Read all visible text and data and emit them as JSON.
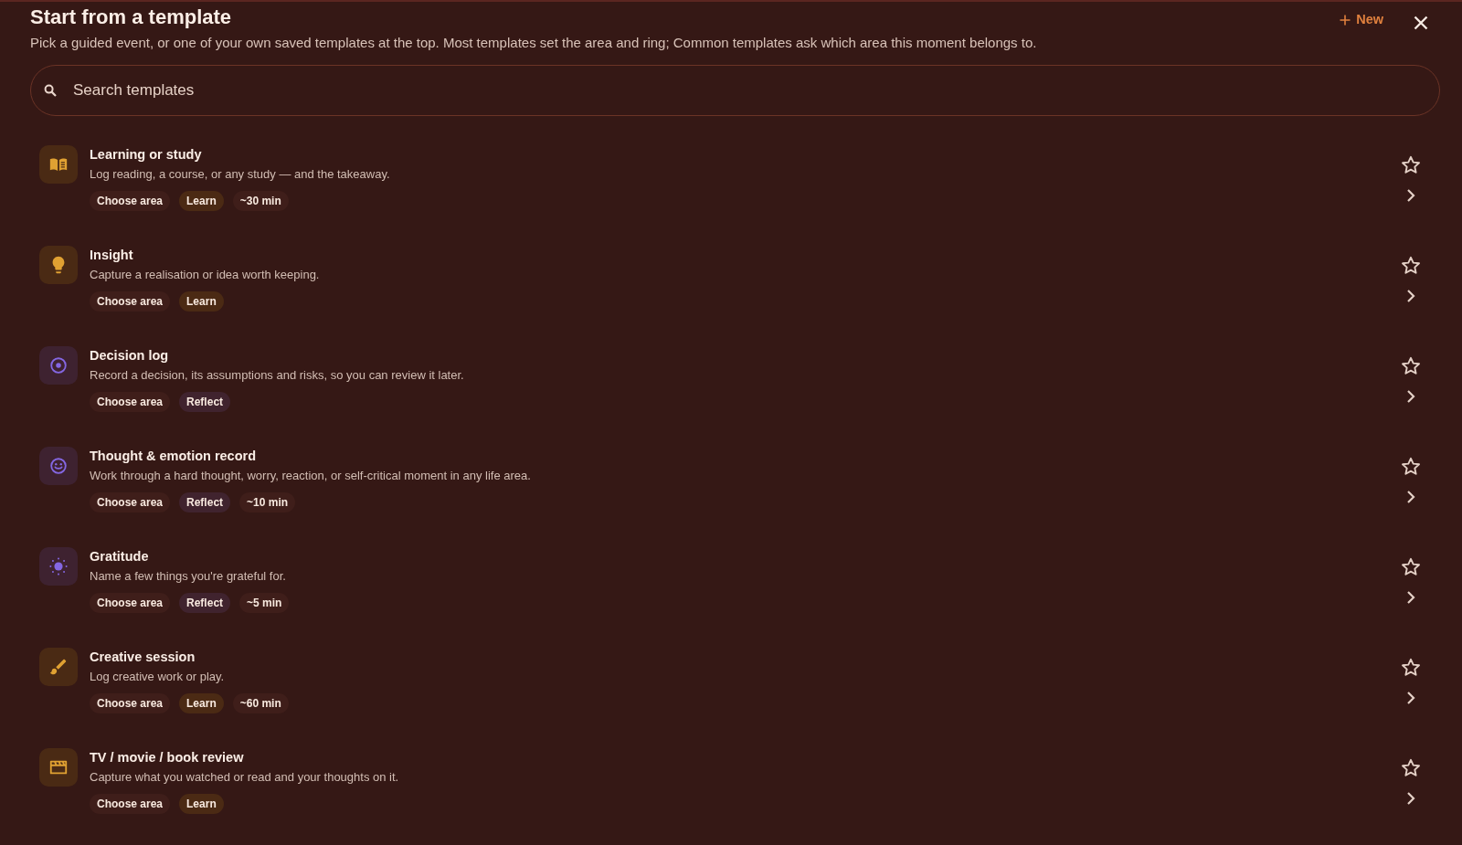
{
  "header": {
    "title": "Start from a template",
    "subtitle": "Pick a guided event, or one of your own saved templates at the top. Most templates set the area and ring; Common templates ask which area this moment belongs to.",
    "new_button": {
      "label": "New"
    }
  },
  "search": {
    "placeholder": "Search templates"
  },
  "templates": [
    {
      "title": "Learning or study",
      "description": "Log reading, a course, or any study — and the takeaway.",
      "tags": [
        {
          "label": "Choose area",
          "kind": "area"
        },
        {
          "label": "Learn",
          "kind": "learn"
        },
        {
          "label": "~30 min",
          "kind": "duration"
        }
      ],
      "favorite": false
    },
    {
      "title": "Insight",
      "description": "Capture a realisation or idea worth keeping.",
      "tags": [
        {
          "label": "Choose area",
          "kind": "area"
        },
        {
          "label": "Learn",
          "kind": "learn"
        }
      ],
      "favorite": false
    },
    {
      "title": "Decision log",
      "description": "Record a decision, its assumptions and risks, so you can review it later.",
      "tags": [
        {
          "label": "Choose area",
          "kind": "area"
        },
        {
          "label": "Reflect",
          "kind": "reflect"
        }
      ],
      "favorite": false
    },
    {
      "title": "Thought & emotion record",
      "description": "Work through a hard thought, worry, reaction, or self-critical moment in any life area.",
      "tags": [
        {
          "label": "Choose area",
          "kind": "area"
        },
        {
          "label": "Reflect",
          "kind": "reflect"
        },
        {
          "label": "~10 min",
          "kind": "duration"
        }
      ],
      "favorite": false
    },
    {
      "title": "Gratitude",
      "description": "Name a few things you're grateful for.",
      "tags": [
        {
          "label": "Choose area",
          "kind": "area"
        },
        {
          "label": "Reflect",
          "kind": "reflect"
        },
        {
          "label": "~5 min",
          "kind": "duration"
        }
      ],
      "favorite": false
    },
    {
      "title": "Creative session",
      "description": "Log creative work or play.",
      "tags": [
        {
          "label": "Choose area",
          "kind": "area"
        },
        {
          "label": "Learn",
          "kind": "learn"
        },
        {
          "label": "~60 min",
          "kind": "duration"
        }
      ],
      "favorite": false
    },
    {
      "title": "TV / movie / book review",
      "description": "Capture what you watched or read and your thoughts on it.",
      "tags": [
        {
          "label": "Choose area",
          "kind": "area"
        },
        {
          "label": "Learn",
          "kind": "learn"
        }
      ],
      "favorite": false
    }
  ]
}
